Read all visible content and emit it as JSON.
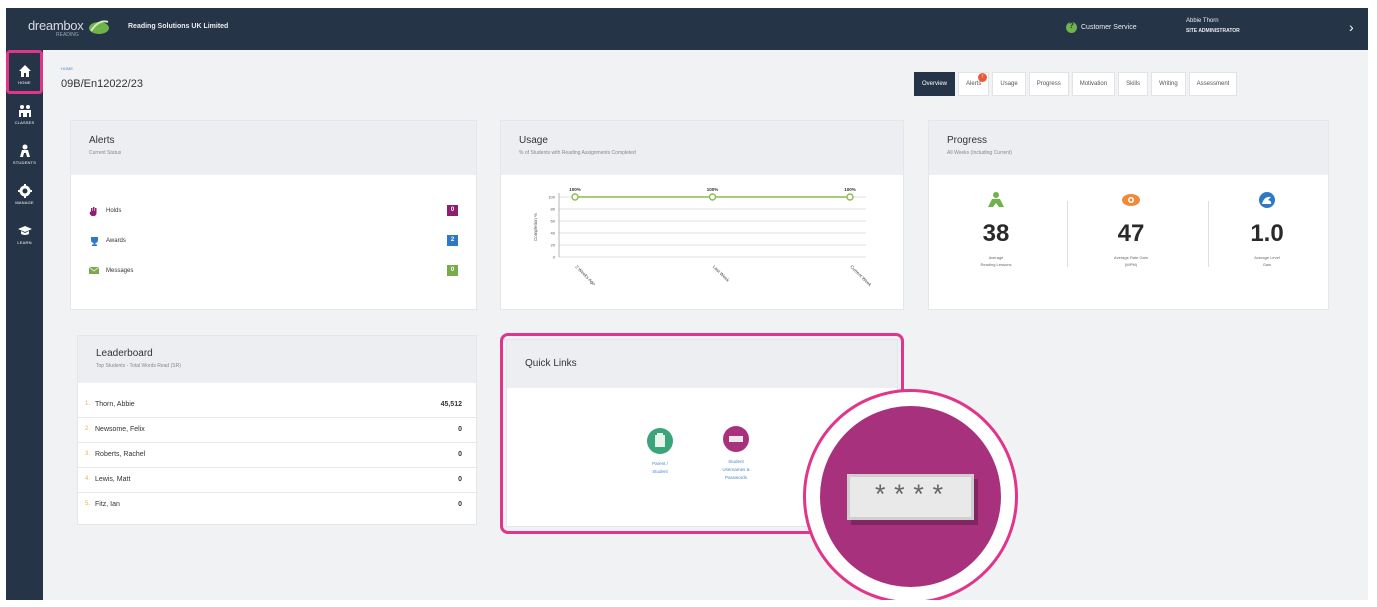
{
  "topbar": {
    "logo": "dreambox",
    "logo_sub": "READING",
    "org_name": "Reading Solutions UK Limited",
    "customer_service": "Customer Service",
    "user_name": "Abbie Thorn",
    "user_role": "SITE ADMINISTRATOR"
  },
  "sidebar": {
    "items": [
      {
        "label": "HOME",
        "icon": "home-icon"
      },
      {
        "label": "CLASSES",
        "icon": "classes-icon"
      },
      {
        "label": "STUDENTS",
        "icon": "students-icon"
      },
      {
        "label": "MANAGE",
        "icon": "gear-icon"
      },
      {
        "label": "LEARN",
        "icon": "graduation-cap-icon"
      }
    ],
    "active": "CLASSES"
  },
  "header": {
    "breadcrumb": "HOME",
    "title": "09B/En12022/23"
  },
  "tabs": [
    {
      "label": "Overview",
      "active": true
    },
    {
      "label": "Alerts",
      "badge": "!"
    },
    {
      "label": "Usage"
    },
    {
      "label": "Progress"
    },
    {
      "label": "Motivation"
    },
    {
      "label": "Skills"
    },
    {
      "label": "Writing"
    },
    {
      "label": "Assessment"
    }
  ],
  "alerts_card": {
    "title": "Alerts",
    "subtitle": "Current Status",
    "rows": [
      {
        "label": "Holds",
        "count": "0",
        "color": "#8e1f6e"
      },
      {
        "label": "Awards",
        "count": "2",
        "color": "#2f78c4"
      },
      {
        "label": "Messages",
        "count": "0",
        "color": "#7aab4a"
      }
    ]
  },
  "usage_card": {
    "title": "Usage",
    "subtitle": "% of Students with Reading Assignments Completed",
    "ylabel": "Completion %",
    "yticks": [
      "100",
      "80",
      "60",
      "40",
      "20",
      "0"
    ],
    "points": [
      {
        "label": "2 Weeks Ago",
        "value": 100,
        "display": "100%"
      },
      {
        "label": "Last Week",
        "value": 100,
        "display": "100%"
      },
      {
        "label": "Current Week",
        "value": 100,
        "display": "100%"
      }
    ]
  },
  "progress_card": {
    "title": "Progress",
    "subtitle": "All Weeks (Including Current)",
    "metrics": [
      {
        "value": "38",
        "label1": "Average",
        "label2": "Reading Lessons",
        "icon": "reader-icon",
        "color": "#6fb34a"
      },
      {
        "value": "47",
        "label1": "Average Rate Gain",
        "label2": "(WPM)",
        "icon": "eye-icon",
        "color": "#f08a3a"
      },
      {
        "value": "1.0",
        "label1": "Average Level",
        "label2": "Gain",
        "icon": "level-icon",
        "color": "#2f78c4"
      }
    ]
  },
  "leaderboard": {
    "title": "Leaderboard",
    "subtitle": "Top Students - Total Words Read (SR)",
    "rows": [
      {
        "rank": "1.",
        "name": "Thorn, Abbie",
        "score": "45,512"
      },
      {
        "rank": "2.",
        "name": "Newsome, Felix",
        "score": "0"
      },
      {
        "rank": "3.",
        "name": "Roberts, Rachel",
        "score": "0"
      },
      {
        "rank": "4.",
        "name": "Lewis, Matt",
        "score": "0"
      },
      {
        "rank": "5.",
        "name": "Fitz, Ian",
        "score": "0"
      }
    ]
  },
  "quick_links": {
    "title": "Quick Links",
    "links": [
      {
        "label1": "Parent /",
        "label2": "Student",
        "label3": "",
        "icon": "clipboard-icon",
        "color": "#3aa57a"
      },
      {
        "label1": "Student",
        "label2": "Usernames &",
        "label3": "Passwords",
        "icon": "password-icon",
        "color": "#a8317e"
      }
    ]
  },
  "zoom": {
    "password_mask": "****"
  }
}
